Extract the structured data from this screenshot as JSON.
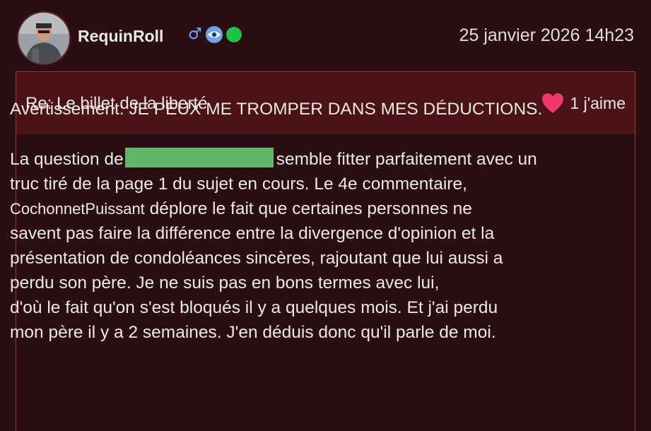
{
  "post": {
    "author": "RequinRoll",
    "date": "25 janvier 2026 14h23",
    "badges": [
      "male-icon",
      "eye-badge-icon",
      "online-status-dot"
    ],
    "colors": {
      "background": "#2a0f12",
      "title_bar": "#4b1315",
      "border": "#a5353b",
      "heart": "#f0386b",
      "redaction": "#5fb86a",
      "male_symbol": "#6fa8ff",
      "online": "#1fc24a"
    },
    "title": "Re: Le billet de la liberté",
    "likes": "1 j'aime",
    "warning": "Avertissement: JE PEUX ME TROMPER DANS MES DÉDUCTIONS.",
    "body": {
      "line1_pre": "La question de",
      "line1_post": "semble fitter parfaitement avec un",
      "line2": "truc tiré de la page 1 du sujet en cours. Le 4e commentaire,",
      "mention": "CochonnetPuissant",
      "line3_post": " déplore  le fait que certaines personnes ne",
      "line4": "savent pas faire la différence entre la divergence d'opinion et la",
      "line5": "présentation de condoléances sincères, rajoutant que lui aussi a",
      "line6": "perdu son père. Je ne suis pas en bons termes avec lui,",
      "line7": "d'où le fait qu'on s'est bloqués il y a quelques mois. Et j'ai perdu",
      "line8": "mon père il y a 2 semaines. J'en déduis donc qu'il parle de moi."
    }
  }
}
